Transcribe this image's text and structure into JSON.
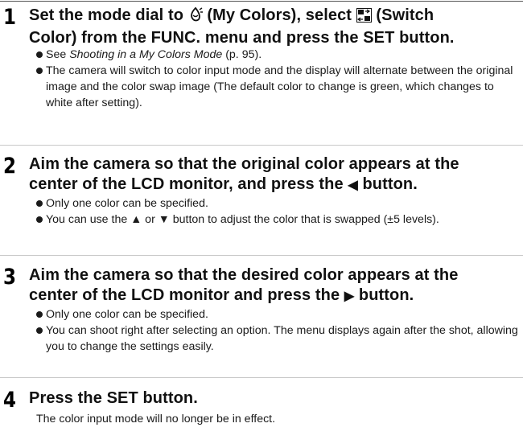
{
  "steps": [
    {
      "number": "1",
      "title_a": "Set the mode dial to ",
      "title_b": " (My Colors), select ",
      "title_c": " (Switch",
      "title_line2": "Color) from the FUNC. menu and press the SET button.",
      "bullets": [
        {
          "prefix": "See ",
          "italic": "Shooting in a My Colors Mode",
          "suffix": " (p. 95)."
        },
        {
          "text": "The camera will switch to color input mode and the display will alternate between the original image and the color swap image (The default color to change is green, which changes to white after setting)."
        }
      ]
    },
    {
      "number": "2",
      "title_line1": "Aim the camera so that the original color appears at the",
      "title_line2_a": "center of the LCD monitor, and press the ",
      "title_line2_b": " button.",
      "bullets": [
        {
          "text": "Only one color can be specified."
        },
        {
          "text_a": "You can use the ",
          "text_b": " or ",
          "text_c": " button to adjust the color that is swapped (±5 levels)."
        }
      ]
    },
    {
      "number": "3",
      "title_line1": "Aim the camera so that the desired color appears at the",
      "title_line2_a": "center of the LCD monitor and press the ",
      "title_line2_b": " button.",
      "bullets": [
        {
          "text": "Only one color can be specified."
        },
        {
          "text": "You can shoot right after selecting an option. The menu displays again after the shot, allowing you to change the settings easily."
        }
      ]
    },
    {
      "number": "4",
      "title": "Press the SET button.",
      "body": "The color input mode will no longer be in effect."
    }
  ],
  "icons": {
    "mode_dial": "my-colors-icon",
    "func_item": "switch-color-icon",
    "left_button": "left-arrow-icon",
    "up_button": "up-arrow-icon",
    "down_button": "down-arrow-icon",
    "right_button": "right-arrow-icon"
  },
  "colors": {
    "text": "#111111",
    "rule": "#c8c8c8"
  }
}
